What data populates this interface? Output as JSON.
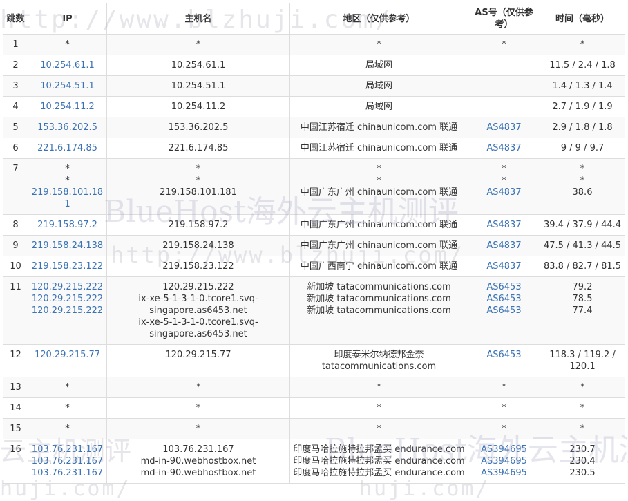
{
  "headers": {
    "hop": "跳数",
    "ip": "IP",
    "host": "主机名",
    "region": "地区（仅供参考）",
    "as": "AS号（仅供参考）",
    "time": "时间（毫秒）"
  },
  "rows": [
    {
      "hop": "1",
      "ip": [
        "*"
      ],
      "host": [
        "*"
      ],
      "region": [
        "*"
      ],
      "as": [
        "*"
      ],
      "time": [
        "*"
      ]
    },
    {
      "hop": "2",
      "ip": [
        "10.254.61.1"
      ],
      "host": [
        "10.254.61.1"
      ],
      "region": [
        "局域网"
      ],
      "as": [],
      "time": [
        "11.5 / 2.4 / 1.8"
      ]
    },
    {
      "hop": "3",
      "ip": [
        "10.254.51.1"
      ],
      "host": [
        "10.254.51.1"
      ],
      "region": [
        "局域网"
      ],
      "as": [],
      "time": [
        "1.4 / 1.3 / 1.4"
      ]
    },
    {
      "hop": "4",
      "ip": [
        "10.254.11.2"
      ],
      "host": [
        "10.254.11.2"
      ],
      "region": [
        "局域网"
      ],
      "as": [],
      "time": [
        "2.7 / 1.9 / 1.9"
      ]
    },
    {
      "hop": "5",
      "ip": [
        "153.36.202.5"
      ],
      "host": [
        "153.36.202.5"
      ],
      "region": [
        "中国江苏宿迁 chinaunicom.com 联通"
      ],
      "as": [
        "AS4837"
      ],
      "time": [
        "2.9 / 1.8 / 1.8"
      ]
    },
    {
      "hop": "6",
      "ip": [
        "221.6.174.85"
      ],
      "host": [
        "221.6.174.85"
      ],
      "region": [
        "中国江苏宿迁 chinaunicom.com 联通"
      ],
      "as": [
        "AS4837"
      ],
      "time": [
        "9 / 9 / 9.7"
      ]
    },
    {
      "hop": "7",
      "ip": [
        "*",
        "*",
        "219.158.101.181"
      ],
      "host": [
        "*",
        "*",
        "219.158.101.181"
      ],
      "region": [
        "*",
        "*",
        "中国广东广州 chinaunicom.com 联通"
      ],
      "as": [
        "*",
        "*",
        "AS4837"
      ],
      "time": [
        "*",
        "*",
        "38.6"
      ]
    },
    {
      "hop": "8",
      "ip": [
        "219.158.97.2"
      ],
      "host": [
        "219.158.97.2"
      ],
      "region": [
        "中国广东广州 chinaunicom.com 联通"
      ],
      "as": [
        "AS4837"
      ],
      "time": [
        "39.4 / 37.9 / 44.4"
      ]
    },
    {
      "hop": "9",
      "ip": [
        "219.158.24.138"
      ],
      "host": [
        "219.158.24.138"
      ],
      "region": [
        "中国广东广州 chinaunicom.com 联通"
      ],
      "as": [
        "AS4837"
      ],
      "time": [
        "47.5 / 41.3 / 44.5"
      ]
    },
    {
      "hop": "10",
      "ip": [
        "219.158.23.122"
      ],
      "host": [
        "219.158.23.122"
      ],
      "region": [
        "中国广西南宁 chinaunicom.com 联通"
      ],
      "as": [
        "AS4837"
      ],
      "time": [
        "83.8 / 82.7 / 81.5"
      ]
    },
    {
      "hop": "11",
      "ip": [
        "120.29.215.222",
        "120.29.215.222",
        "120.29.215.222"
      ],
      "host": [
        "120.29.215.222",
        "ix-xe-5-1-3-1-0.tcore1.svq-singapore.as6453.net",
        "ix-xe-5-1-3-1-0.tcore1.svq-singapore.as6453.net"
      ],
      "region": [
        "新加坡 tatacommunications.com",
        "新加坡 tatacommunications.com",
        "新加坡 tatacommunications.com"
      ],
      "as": [
        "AS6453",
        "AS6453",
        "AS6453"
      ],
      "time": [
        "79.2",
        "78.5",
        "77.4"
      ]
    },
    {
      "hop": "12",
      "ip": [
        "120.29.215.77"
      ],
      "host": [
        "120.29.215.77"
      ],
      "region": [
        "印度泰米尔纳德邦金奈 tatacommunications.com"
      ],
      "as": [
        "AS6453"
      ],
      "time": [
        "118.3 / 119.2 / 120.1"
      ]
    },
    {
      "hop": "13",
      "ip": [
        "*"
      ],
      "host": [
        "*"
      ],
      "region": [
        "*"
      ],
      "as": [
        "*"
      ],
      "time": [
        "*"
      ]
    },
    {
      "hop": "14",
      "ip": [
        "*"
      ],
      "host": [
        "*"
      ],
      "region": [
        "*"
      ],
      "as": [
        "*"
      ],
      "time": [
        "*"
      ]
    },
    {
      "hop": "15",
      "ip": [
        "*"
      ],
      "host": [
        "*"
      ],
      "region": [
        "*"
      ],
      "as": [
        "*"
      ],
      "time": [
        "*"
      ]
    },
    {
      "hop": "16",
      "ip": [
        "103.76.231.167",
        "103.76.231.167",
        "103.76.231.167"
      ],
      "host": [
        "103.76.231.167",
        "md-in-90.webhostbox.net",
        "md-in-90.webhostbox.net"
      ],
      "region": [
        "印度马哈拉施特拉邦孟买 endurance.com",
        "印度马哈拉施特拉邦孟买 endurance.com",
        "印度马哈拉施特拉邦孟买 endurance.com"
      ],
      "as": [
        "AS394695",
        "AS394695",
        "AS394695"
      ],
      "time": [
        "230.7",
        "230.4",
        "230.5"
      ]
    }
  ],
  "watermarks": {
    "url": "http://www.blzhuji.com/",
    "brand": "BlueHost海外云主机测评",
    "tag": "云主机测评",
    "url_tail": "huji.com/"
  },
  "colors": {
    "link": "#3a72b4",
    "border": "#dddddd",
    "stripe": "#f9f9f9"
  }
}
